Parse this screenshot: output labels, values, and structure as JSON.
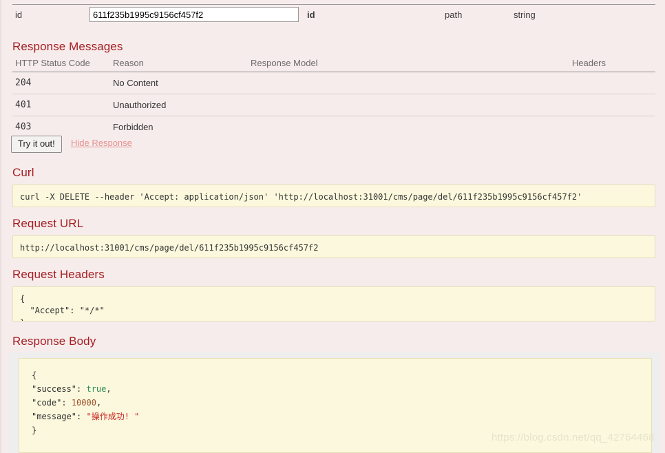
{
  "parameter_row": {
    "name": "id",
    "value": "611f235b1995c9156cf457f2",
    "description": "id",
    "param_type": "path",
    "data_type": "string"
  },
  "response_messages": {
    "title": "Response Messages",
    "columns": {
      "code": "HTTP Status Code",
      "reason": "Reason",
      "model": "Response Model",
      "headers": "Headers"
    },
    "rows": [
      {
        "code": "204",
        "reason": "No Content",
        "model": "",
        "headers": ""
      },
      {
        "code": "401",
        "reason": "Unauthorized",
        "model": "",
        "headers": ""
      },
      {
        "code": "403",
        "reason": "Forbidden",
        "model": "",
        "headers": ""
      }
    ]
  },
  "actions": {
    "try_it_out": "Try it out!",
    "hide_response": "Hide Response"
  },
  "curl": {
    "title": "Curl",
    "command": "curl -X DELETE --header 'Accept: application/json' 'http://localhost:31001/cms/page/del/611f235b1995c9156cf457f2'"
  },
  "request_url": {
    "title": "Request URL",
    "url": "http://localhost:31001/cms/page/del/611f235b1995c9156cf457f2"
  },
  "request_headers": {
    "title": "Request Headers",
    "body": "{\n  \"Accept\": \"*/*\"\n}"
  },
  "response_body": {
    "title": "Response Body",
    "open_brace": "{",
    "close_brace": "}",
    "lines": [
      {
        "key": "\"success\"",
        "sep": ": ",
        "value": "true",
        "kind": "bool",
        "comma": ","
      },
      {
        "key": "\"code\"",
        "sep": ": ",
        "value": "10000",
        "kind": "num",
        "comma": ","
      },
      {
        "key": "\"message\"",
        "sep": ": ",
        "value": "\"操作成功! \"",
        "kind": "str",
        "comma": ""
      }
    ]
  },
  "watermark": "https://blog.csdn.net/qq_42764468",
  "colors": {
    "background": "#f7ecec",
    "heading": "#a41e22",
    "code_bg": "#fbf8dd",
    "code_border": "#e6e0b8",
    "link": "#e39191",
    "json_bool": "#2e8b57",
    "json_num": "#a0522d",
    "json_str": "#cc2222"
  }
}
